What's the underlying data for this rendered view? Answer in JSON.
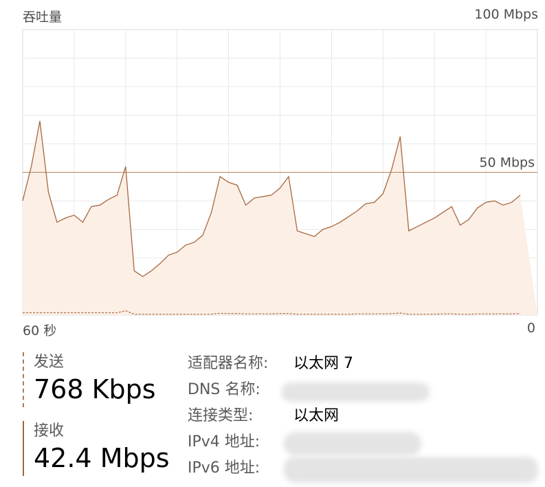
{
  "header": {
    "title": "吞吐量",
    "max_label": "100 Mbps"
  },
  "footer": {
    "time_left": "60 秒",
    "time_right": "0"
  },
  "stats": {
    "send_label": "发送",
    "send_value": "768 Kbps",
    "recv_label": "接收",
    "recv_value": "42.4 Mbps"
  },
  "info": {
    "adapter_key": "适配器名称:",
    "adapter_value": "以太网 7",
    "dns_key": "DNS 名称:",
    "conn_type_key": "连接类型:",
    "conn_type_value": "以太网",
    "ipv4_key": "IPv4 地址:",
    "ipv6_key": "IPv6 地址:"
  },
  "colors": {
    "line": "#a5683e",
    "fill": "#fcefe6",
    "grid": "#e8e8e8",
    "scale_line": "#b5845f",
    "border": "#d9d9d9"
  },
  "chart_data": {
    "type": "area",
    "title": "吞吐量",
    "ylim": [
      0,
      100
    ],
    "scale_line": {
      "value": 50,
      "label": "50 Mbps"
    },
    "x": [
      60,
      59,
      58,
      57,
      56,
      55,
      54,
      53,
      52,
      51,
      50,
      49,
      48,
      47,
      46,
      45,
      44,
      43,
      42,
      41,
      40,
      39,
      38,
      37,
      36,
      35,
      34,
      33,
      32,
      31,
      30,
      29,
      28,
      27,
      26,
      25,
      24,
      23,
      22,
      21,
      20,
      19,
      18,
      17,
      16,
      15,
      14,
      13,
      12,
      11,
      10,
      9,
      8,
      7,
      6,
      5,
      4,
      3,
      2,
      1,
      0
    ],
    "series": [
      {
        "values": [
          40,
          52,
          68,
          43,
          32.5,
          34,
          35,
          32.5,
          38,
          38.5,
          40.5,
          42,
          52,
          15.5,
          13.5,
          15.5,
          18,
          21,
          22,
          24.5,
          25.5,
          28,
          36,
          48.5,
          46.5,
          45.5,
          38.5,
          41,
          41.5,
          42,
          44.5,
          48.5,
          29.5,
          28.5,
          27.5,
          30,
          31,
          32.5,
          34.5,
          36.5,
          39,
          39.5,
          42.5,
          51,
          62.5,
          29.5,
          31,
          32.5,
          34,
          36,
          38,
          31.5,
          33.5,
          37.5,
          39.5,
          40,
          38.5,
          39.5,
          42
        ]
      },
      {
        "values": [
          0.8,
          0.8,
          0.8,
          0.8,
          0.8,
          0.8,
          0.8,
          0.8,
          0.8,
          0.8,
          0.8,
          0.8,
          1.5,
          0.3,
          0.3,
          0.3,
          0.3,
          0.3,
          0.3,
          0.3,
          0.3,
          0.3,
          0.3,
          0.6,
          0.5,
          0.5,
          0.4,
          0.4,
          0.4,
          0.4,
          0.5,
          0.5,
          0.3,
          0.3,
          0.3,
          0.3,
          0.3,
          0.3,
          0.3,
          0.4,
          0.4,
          0.4,
          0.4,
          0.5,
          0.7,
          0.3,
          0.3,
          0.3,
          0.3,
          0.4,
          0.4,
          0.3,
          0.3,
          0.4,
          0.4,
          0.4,
          0.4,
          0.4,
          0.5
        ]
      }
    ]
  }
}
